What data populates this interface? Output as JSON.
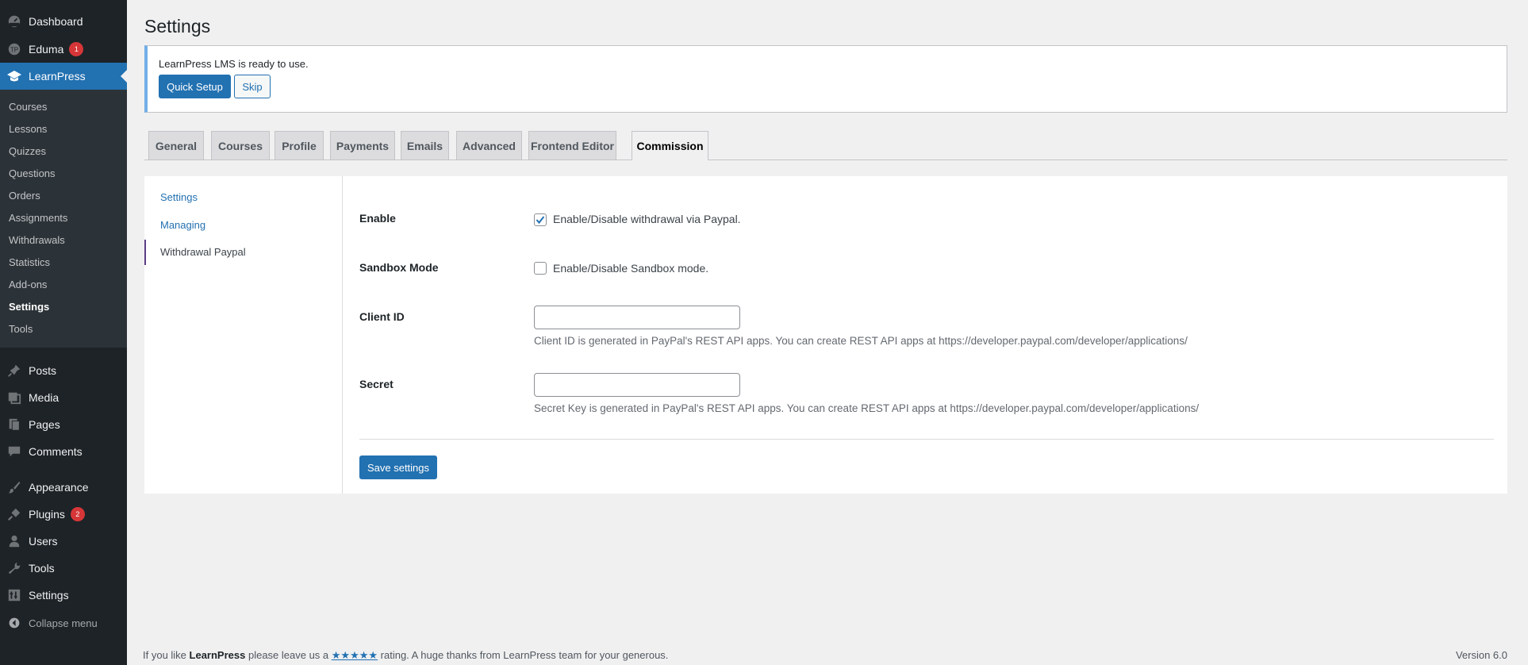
{
  "sidebar": {
    "top_items": [
      {
        "label": "Dashboard",
        "icon": "dashboard-icon"
      },
      {
        "label": "Eduma",
        "icon": "eduma-icon",
        "badge": "1"
      },
      {
        "label": "LearnPress",
        "icon": "graduation-cap-icon"
      }
    ],
    "submenu": [
      "Courses",
      "Lessons",
      "Quizzes",
      "Questions",
      "Orders",
      "Assignments",
      "Withdrawals",
      "Statistics",
      "Add-ons",
      "Settings",
      "Tools"
    ],
    "bottom_items": [
      {
        "label": "Posts",
        "icon": "pin-icon"
      },
      {
        "label": "Media",
        "icon": "media-icon"
      },
      {
        "label": "Pages",
        "icon": "pages-icon"
      },
      {
        "label": "Comments",
        "icon": "comments-icon"
      },
      {
        "label": "Appearance",
        "icon": "brush-icon"
      },
      {
        "label": "Plugins",
        "icon": "plugin-icon",
        "badge": "2"
      },
      {
        "label": "Users",
        "icon": "users-icon"
      },
      {
        "label": "Tools",
        "icon": "wrench-icon"
      },
      {
        "label": "Settings",
        "icon": "settings-icon"
      }
    ],
    "collapse_label": "Collapse menu"
  },
  "page": {
    "title": "Settings"
  },
  "notice": {
    "text": "LearnPress LMS is ready to use.",
    "quick_setup": "Quick Setup",
    "skip": "Skip"
  },
  "tabs": [
    "General",
    "Courses",
    "Profile",
    "Payments",
    "Emails",
    "Advanced",
    "Frontend Editor",
    "Commission"
  ],
  "active_tab": "Commission",
  "side_nav": [
    "Settings",
    "Managing",
    "Withdrawal Paypal"
  ],
  "form": {
    "enable": {
      "label": "Enable",
      "checkbox_label": "Enable/Disable withdrawal via Paypal.",
      "checked": true
    },
    "sandbox": {
      "label": "Sandbox Mode",
      "checkbox_label": "Enable/Disable Sandbox mode.",
      "checked": false
    },
    "client_id": {
      "label": "Client ID",
      "value": "",
      "description": "Client ID is generated in PayPal's REST API apps. You can create REST API apps at https://developer.paypal.com/developer/applications/"
    },
    "secret": {
      "label": "Secret",
      "value": "",
      "description": "Secret Key is generated in PayPal's REST API apps. You can create REST API apps at https://developer.paypal.com/developer/applications/"
    },
    "save_label": "Save settings"
  },
  "footer": {
    "prefix": "If you like ",
    "brand": "LearnPress",
    "middle": " please leave us a ",
    "stars": "★★★★★",
    "suffix": " rating. A huge thanks from LearnPress team for your generous.",
    "version": "Version 6.0"
  },
  "colors": {
    "accent": "#2271b1",
    "sidebar_bg": "#1d2327",
    "badge": "#d63638"
  }
}
